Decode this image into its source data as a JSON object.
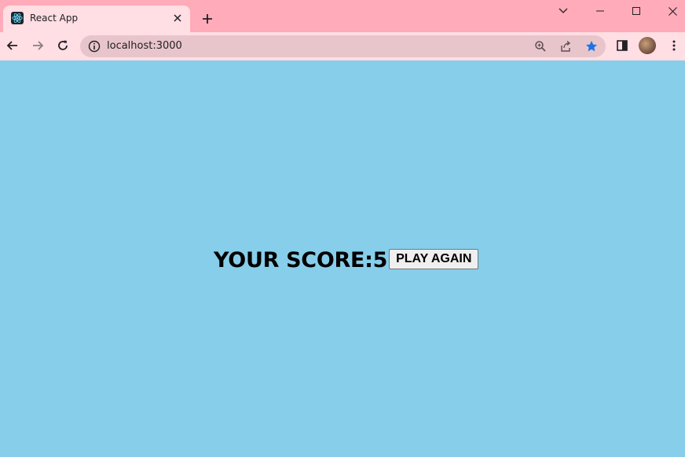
{
  "browser": {
    "tab": {
      "title": "React App",
      "favicon": "react-logo-icon"
    },
    "url": "localhost:3000",
    "bookmarked": true,
    "colors": {
      "titlebar": "#FFABB9",
      "toolbar": "#FFDEE4",
      "omnibox": "#E8C5CB",
      "star": "#1A73E8"
    }
  },
  "page": {
    "background": "#87CEEB",
    "score_label": "YOUR SCORE:",
    "score_value": "5",
    "play_again_label": "PLAY AGAIN"
  }
}
